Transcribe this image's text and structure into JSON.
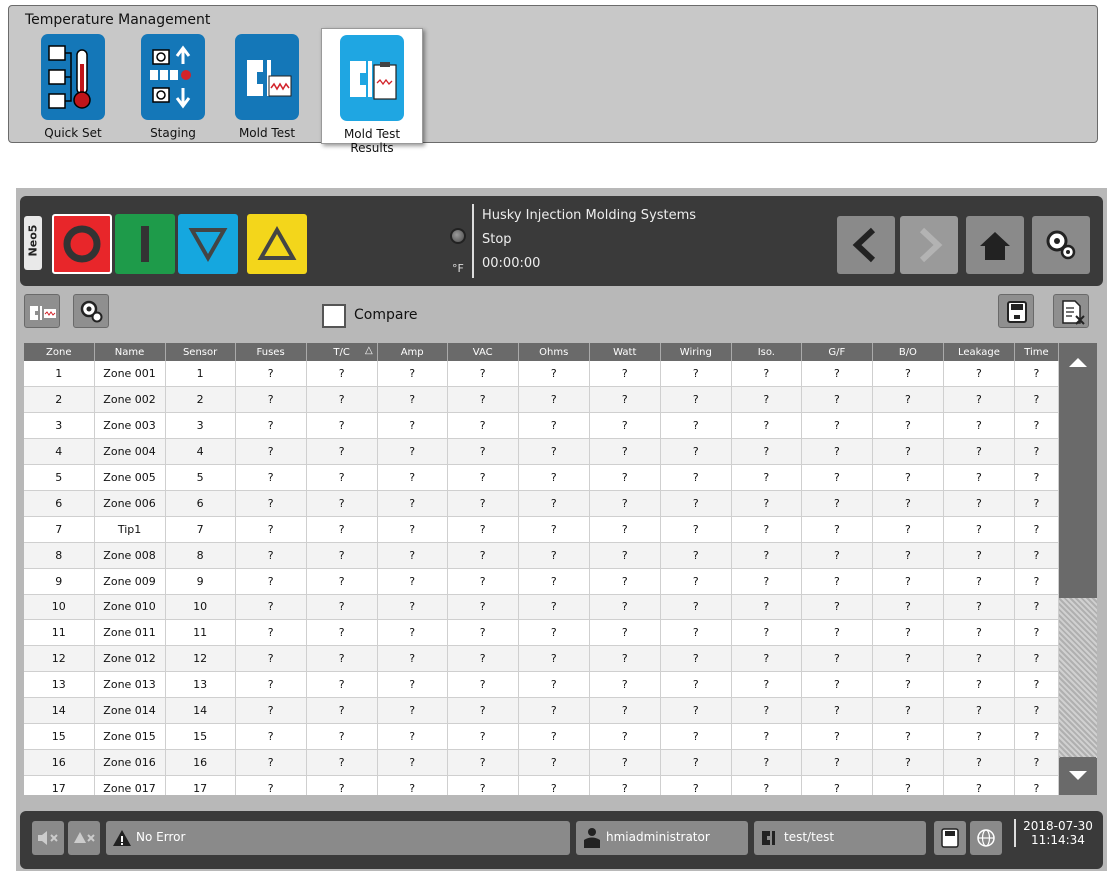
{
  "menu": {
    "title": "Temperature Management",
    "apps": [
      {
        "label": "Quick Set",
        "icon": "thermometer-zones-icon"
      },
      {
        "label": "Staging",
        "icon": "staging-icon"
      },
      {
        "label": "Mold Test",
        "icon": "mold-test-icon"
      },
      {
        "label": "Mold Test Results",
        "icon": "mold-test-results-icon",
        "active": true
      }
    ]
  },
  "header": {
    "tab": "Neo5",
    "company": "Husky Injection Molding Systems",
    "status": "Stop",
    "timer": "00:00:00",
    "unit": "°F"
  },
  "toolbar": {
    "compare_label": "Compare"
  },
  "table": {
    "columns": [
      "Zone",
      "Name",
      "Sensor",
      "Fuses",
      "T/C",
      "Amp",
      "VAC",
      "Ohms",
      "Watt",
      "Wiring",
      "Iso.",
      "G/F",
      "B/O",
      "Leakage",
      "Time"
    ],
    "rows": [
      [
        "1",
        "Zone 001",
        "1",
        "?",
        "?",
        "?",
        "?",
        "?",
        "?",
        "?",
        "?",
        "?",
        "?",
        "?",
        "?"
      ],
      [
        "2",
        "Zone 002",
        "2",
        "?",
        "?",
        "?",
        "?",
        "?",
        "?",
        "?",
        "?",
        "?",
        "?",
        "?",
        "?"
      ],
      [
        "3",
        "Zone 003",
        "3",
        "?",
        "?",
        "?",
        "?",
        "?",
        "?",
        "?",
        "?",
        "?",
        "?",
        "?",
        "?"
      ],
      [
        "4",
        "Zone 004",
        "4",
        "?",
        "?",
        "?",
        "?",
        "?",
        "?",
        "?",
        "?",
        "?",
        "?",
        "?",
        "?"
      ],
      [
        "5",
        "Zone 005",
        "5",
        "?",
        "?",
        "?",
        "?",
        "?",
        "?",
        "?",
        "?",
        "?",
        "?",
        "?",
        "?"
      ],
      [
        "6",
        "Zone 006",
        "6",
        "?",
        "?",
        "?",
        "?",
        "?",
        "?",
        "?",
        "?",
        "?",
        "?",
        "?",
        "?"
      ],
      [
        "7",
        "Tip1",
        "7",
        "?",
        "?",
        "?",
        "?",
        "?",
        "?",
        "?",
        "?",
        "?",
        "?",
        "?",
        "?"
      ],
      [
        "8",
        "Zone 008",
        "8",
        "?",
        "?",
        "?",
        "?",
        "?",
        "?",
        "?",
        "?",
        "?",
        "?",
        "?",
        "?"
      ],
      [
        "9",
        "Zone 009",
        "9",
        "?",
        "?",
        "?",
        "?",
        "?",
        "?",
        "?",
        "?",
        "?",
        "?",
        "?",
        "?"
      ],
      [
        "10",
        "Zone 010",
        "10",
        "?",
        "?",
        "?",
        "?",
        "?",
        "?",
        "?",
        "?",
        "?",
        "?",
        "?",
        "?"
      ],
      [
        "11",
        "Zone 011",
        "11",
        "?",
        "?",
        "?",
        "?",
        "?",
        "?",
        "?",
        "?",
        "?",
        "?",
        "?",
        "?"
      ],
      [
        "12",
        "Zone 012",
        "12",
        "?",
        "?",
        "?",
        "?",
        "?",
        "?",
        "?",
        "?",
        "?",
        "?",
        "?",
        "?"
      ],
      [
        "13",
        "Zone 013",
        "13",
        "?",
        "?",
        "?",
        "?",
        "?",
        "?",
        "?",
        "?",
        "?",
        "?",
        "?",
        "?"
      ],
      [
        "14",
        "Zone 014",
        "14",
        "?",
        "?",
        "?",
        "?",
        "?",
        "?",
        "?",
        "?",
        "?",
        "?",
        "?",
        "?"
      ],
      [
        "15",
        "Zone 015",
        "15",
        "?",
        "?",
        "?",
        "?",
        "?",
        "?",
        "?",
        "?",
        "?",
        "?",
        "?",
        "?"
      ],
      [
        "16",
        "Zone 016",
        "16",
        "?",
        "?",
        "?",
        "?",
        "?",
        "?",
        "?",
        "?",
        "?",
        "?",
        "?",
        "?"
      ],
      [
        "17",
        "Zone 017",
        "17",
        "?",
        "?",
        "?",
        "?",
        "?",
        "?",
        "?",
        "?",
        "?",
        "?",
        "?",
        "?"
      ]
    ]
  },
  "footer": {
    "error": "No Error",
    "user": "hmiadministrator",
    "mold": "test/test",
    "date": "2018-07-30",
    "time": "11:14:34"
  }
}
